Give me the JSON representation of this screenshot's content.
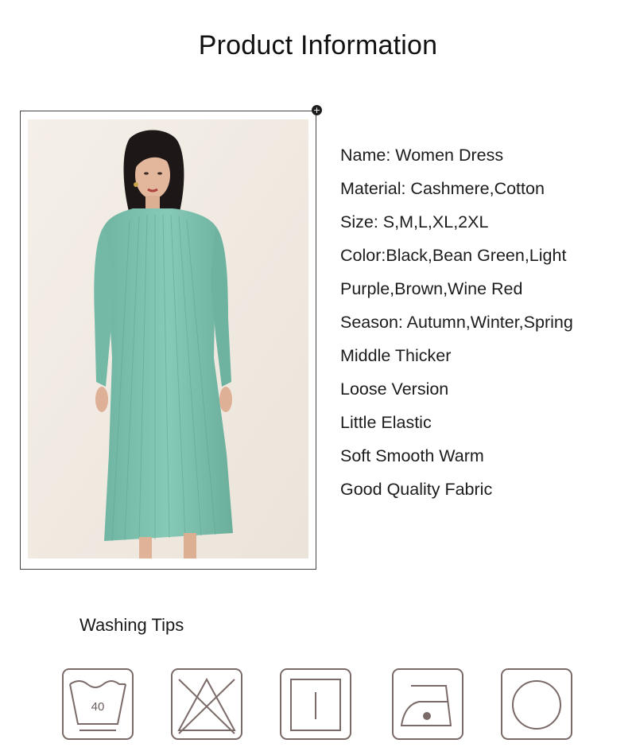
{
  "page": {
    "title": "Product Information"
  },
  "product": {
    "info_lines": [
      "Name: Women Dress",
      "Material: Cashmere,Cotton",
      "Size: S,M,L,XL,2XL",
      "Color:Black,Bean Green,Light",
      "Purple,Brown,Wine Red",
      "Season: Autumn,Winter,Spring",
      "Middle Thicker",
      "Loose Version",
      "Little Elastic",
      "Soft Smooth Warm",
      "Good Quality Fabric"
    ],
    "dress_color": "#7fc2b0"
  },
  "washing": {
    "title": "Washing Tips",
    "wash_temperature": "40",
    "icons": [
      "wash-40-icon",
      "do-not-bleach-icon",
      "dry-flat-icon",
      "iron-low-icon",
      "dry-clean-icon"
    ],
    "icon_color": "#7a6a68"
  }
}
